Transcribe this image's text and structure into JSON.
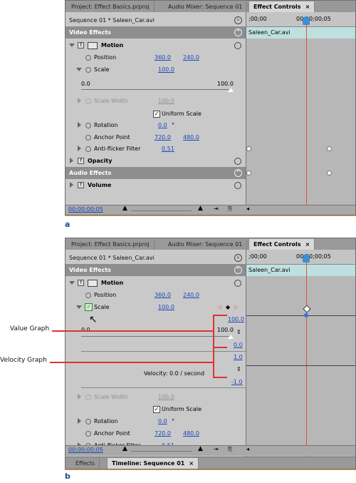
{
  "tabs": {
    "project": "Project: Effect Basics.prproj",
    "audio_mixer": "Audio Mixer: Sequence 01",
    "effect_controls": "Effect Controls",
    "close": "×"
  },
  "sequence_label": "Sequence 01 * Saleen_Car.avi",
  "video_effects": "Video Effects",
  "audio_effects": "Audio Effects",
  "motion": "Motion",
  "position": {
    "label": "Position",
    "x": "360.0",
    "y": "240.0"
  },
  "scale": {
    "label": "Scale",
    "value": "100.0",
    "slider_min": "0.0",
    "slider_max": "100.0"
  },
  "scale_width": {
    "label": "Scale Width",
    "value": "100.0"
  },
  "uniform_scale": "Uniform Scale",
  "rotation": {
    "label": "Rotation",
    "value": "0.0",
    "unit": "°"
  },
  "anchor_point": {
    "label": "Anchor Point",
    "x": "720.0",
    "y": "480.0"
  },
  "anti_flicker": {
    "label": "Anti-flicker Filter",
    "value": "0.51"
  },
  "opacity": "Opacity",
  "volume": "Volume",
  "timecode_start": ";00;00",
  "timecode_mid": "00;00;00;05",
  "clip_name": "Saleen_Car.avi",
  "current_time": "00;00;00;05",
  "graph": {
    "value_max": "100.0",
    "value_min": "0.0",
    "velocity_max": "1.0",
    "velocity_min": "-1.0",
    "velocity_text": "Velocity: 0.0 / second"
  },
  "callouts": {
    "value_graph": "Value Graph",
    "velocity_graph": "Velocity Graph"
  },
  "captions": {
    "a": "a",
    "b": "b"
  },
  "bottom_tabs": {
    "effects": "Effects",
    "timeline": "Timeline: Sequence 01",
    "close": "×"
  },
  "colors": {
    "accent_blue": "#1a48b8",
    "playhead_red": "#e05030",
    "callout_red": "#d33333",
    "clip_teal": "#bfe0e0"
  }
}
